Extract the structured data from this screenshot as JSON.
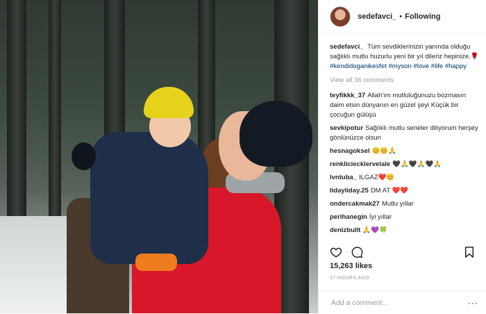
{
  "post": {
    "username": "sedefavci_",
    "follow_status": "Following",
    "caption_text": "Tüm sevdiklerinizin yanında olduğu sağlıklı mutlu huzurlu yeni bir yıl dileriz hepinize.🌹",
    "caption_tags": [
      "#kendidoganikesfet",
      "#myson",
      "#love",
      "#life",
      "#happy"
    ],
    "view_all": "View all 36 comments",
    "likes": "15,263 likes",
    "time": "17 HOURS AGO",
    "add_comment_placeholder": "Add a comment...",
    "more": "···"
  },
  "comments": [
    {
      "user": "teyfikkk_37",
      "text": "Allah'ım mutluluğunuzu bozmasın daim etsin dünyanın en güzel şeyi Küçük bir çocuğun gülüşü"
    },
    {
      "user": "sevkipotur",
      "text": "Sağlıklı mutlu seneler diliyorum herşey gönlünüzce olsun"
    },
    {
      "user": "hesnagoksel",
      "text": "😊😊🙏"
    },
    {
      "user": "renklicieckler­velale",
      "text": "🖤🙏🖤🙏🖤🙏"
    },
    {
      "user": "lvntuba_",
      "text": "ILGAZ❤️😊"
    },
    {
      "user": "lidayliday.25",
      "text": "DM AT ❤️❤️"
    },
    {
      "user": "ondercakmak27",
      "text": "Mutlu yıllar"
    },
    {
      "user": "perihanegin",
      "text": "İyi yıllar"
    },
    {
      "user": "denizbullt",
      "text": "🙏💜🍀"
    }
  ],
  "icons": {
    "like": "heart-icon",
    "comment": "comment-icon",
    "save": "bookmark-icon"
  }
}
